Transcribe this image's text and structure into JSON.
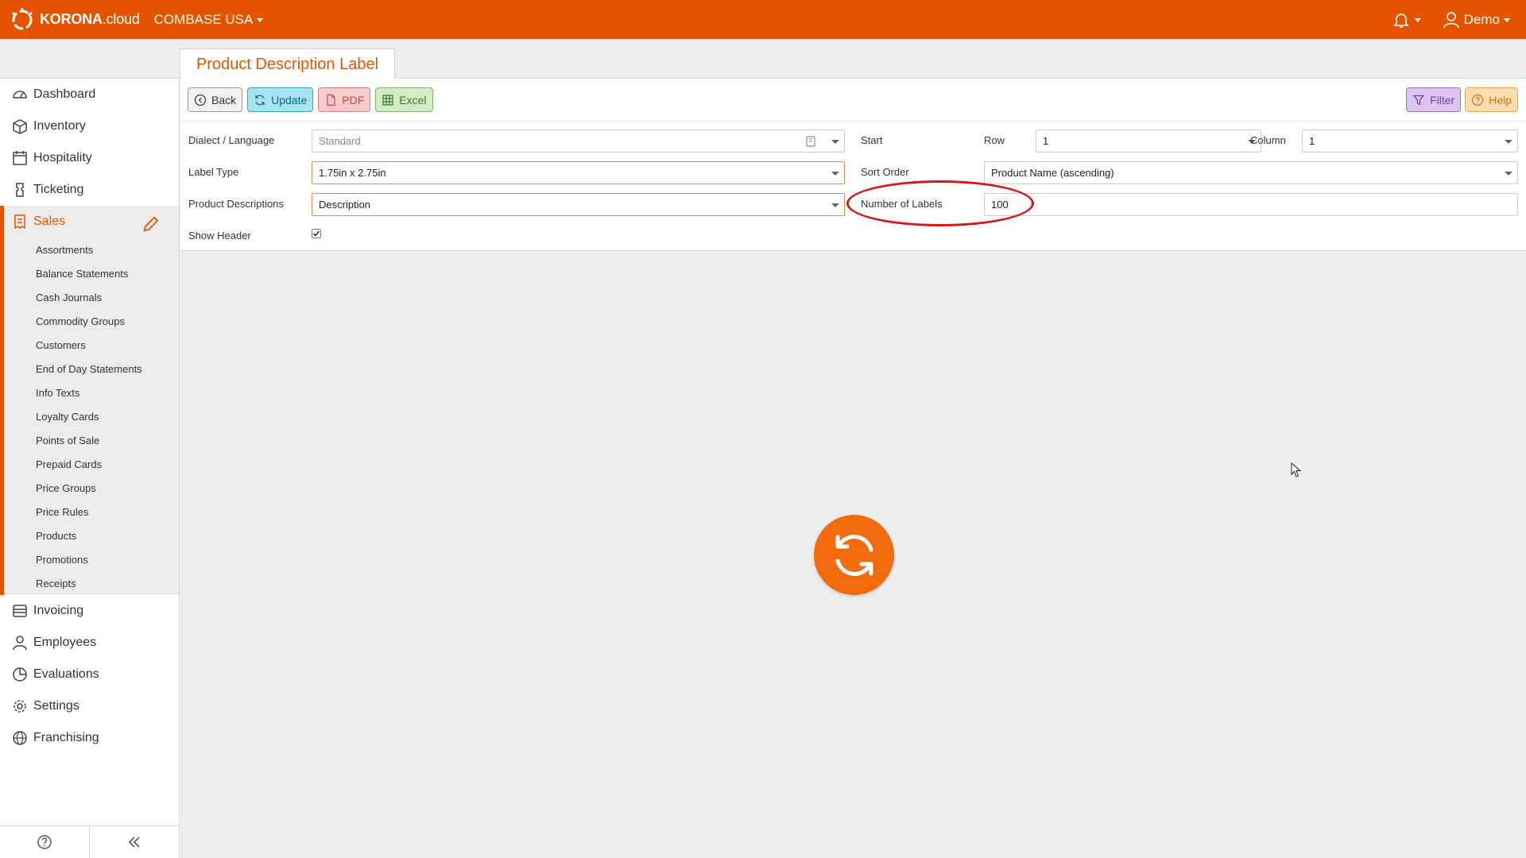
{
  "header": {
    "logo_bold": "KORONA",
    "logo_light": ".cloud",
    "company": "COMBASE USA",
    "user": "Demo"
  },
  "tab": {
    "title": "Product Description Label"
  },
  "toolbar": {
    "back": "Back",
    "update": "Update",
    "pdf": "PDF",
    "excel": "Excel",
    "filter": "Filter",
    "help": "Help"
  },
  "form": {
    "dialect_label": "Dialect / Language",
    "dialect_value": "Standard",
    "label_type_label": "Label Type",
    "label_type_value": "1.75in x 2.75in",
    "product_desc_label": "Product Descriptions",
    "product_desc_value": "Description",
    "show_header_label": "Show Header",
    "start_label": "Start",
    "row_label": "Row",
    "row_value": "1",
    "column_label": "Column",
    "column_value": "1",
    "sort_order_label": "Sort Order",
    "sort_order_value": "Product Name (ascending)",
    "num_labels_label": "Number of Labels",
    "num_labels_value": "100"
  },
  "sidebar": {
    "items": [
      {
        "label": "Dashboard",
        "icon": "dashboard-icon"
      },
      {
        "label": "Inventory",
        "icon": "box-icon"
      },
      {
        "label": "Hospitality",
        "icon": "calendar-icon"
      },
      {
        "label": "Ticketing",
        "icon": "ticket-icon"
      }
    ],
    "sales": {
      "label": "Sales",
      "sub": [
        "Assortments",
        "Balance Statements",
        "Cash Journals",
        "Commodity Groups",
        "Customers",
        "End of Day Statements",
        "Info Texts",
        "Loyalty Cards",
        "Points of Sale",
        "Prepaid Cards",
        "Price Groups",
        "Price Rules",
        "Products",
        "Promotions",
        "Receipts"
      ]
    },
    "items_after": [
      {
        "label": "Invoicing",
        "icon": "invoice-icon"
      },
      {
        "label": "Employees",
        "icon": "employees-icon"
      },
      {
        "label": "Evaluations",
        "icon": "pie-chart-icon"
      },
      {
        "label": "Settings",
        "icon": "gear-icon"
      },
      {
        "label": "Franchising",
        "icon": "globe-icon"
      }
    ]
  },
  "colors": {
    "accent": "#e55300",
    "loader": "#f26b0f",
    "annotation": "#d11a1a"
  }
}
